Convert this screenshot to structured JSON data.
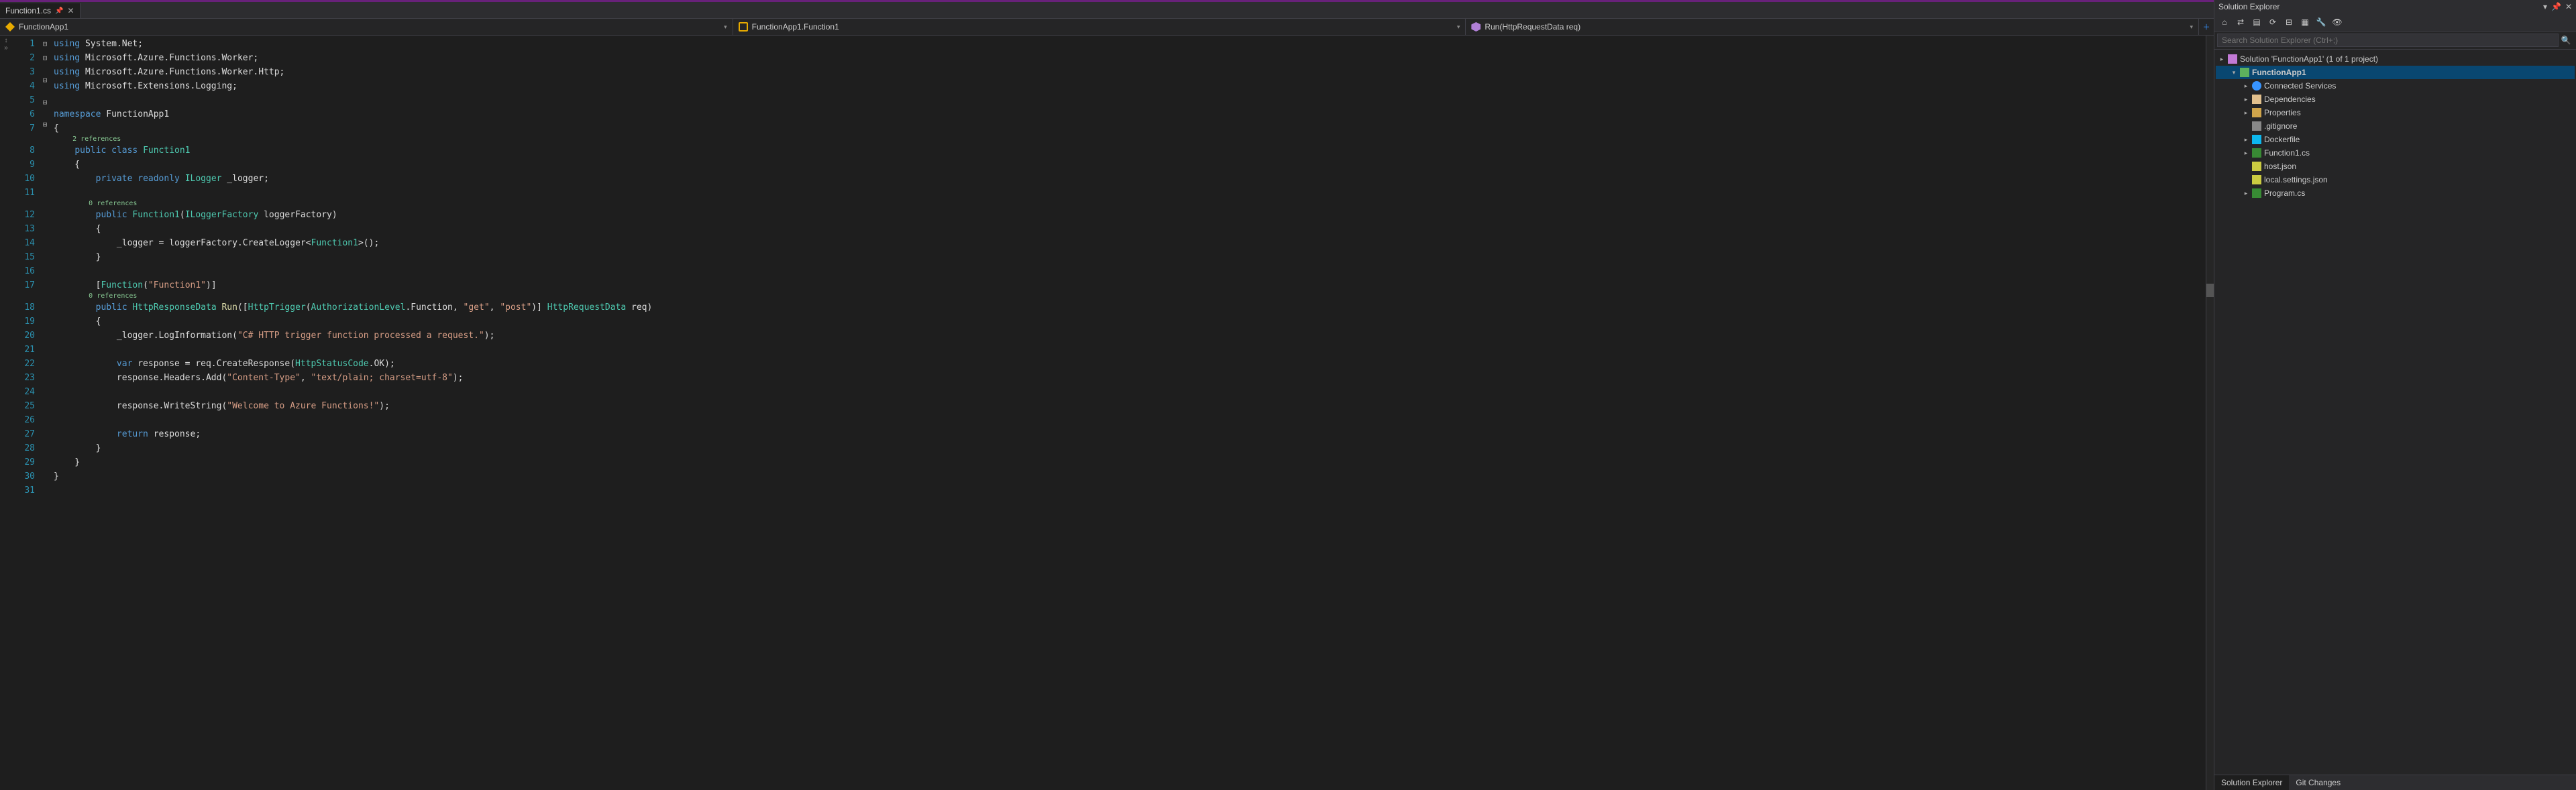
{
  "tabs": {
    "file": "Function1.cs"
  },
  "nav": {
    "ns": "FunctionApp1",
    "cls": "FunctionApp1.Function1",
    "mtd": "Run(HttpRequestData req)"
  },
  "code": {
    "lines": 31,
    "foldables": [
      1,
      6,
      8,
      12,
      18
    ],
    "codelens": [
      {
        "before_line": 8,
        "indent": 4,
        "text": "2 references"
      },
      {
        "before_line": 12,
        "indent": 8,
        "text": "0 references"
      },
      {
        "before_line": 18,
        "indent": 8,
        "text": "0 references"
      }
    ],
    "src": {
      "l1": "<span class='kw'>using</span> System.Net;",
      "l2": "<span class='kw'>using</span> Microsoft.Azure.Functions.Worker;",
      "l3": "<span class='kw'>using</span> Microsoft.Azure.Functions.Worker.Http;",
      "l4": "<span class='kw'>using</span> Microsoft.Extensions.Logging;",
      "l5": "",
      "l6": "<span class='kw'>namespace</span> FunctionApp1",
      "l7": "{",
      "l8": "    <span class='kw'>public class</span> <span class='ty'>Function1</span>",
      "l9": "    {",
      "l10": "        <span class='kw'>private readonly</span> <span class='ty'>ILogger</span> _logger;",
      "l11": "",
      "l12": "        <span class='kw'>public</span> <span class='ty'>Function1</span>(<span class='ty'>ILoggerFactory</span> loggerFactory)",
      "l13": "        {",
      "l14": "            _logger = loggerFactory.CreateLogger&lt;<span class='ty'>Function1</span>&gt;();",
      "l15": "        }",
      "l16": "",
      "l17": "        [<span class='ty'>Function</span>(<span class='str'>\"Function1\"</span>)]",
      "l18": "        <span class='kw'>public</span> <span class='ty'>HttpResponseData</span> <span class='mth'>Run</span>([<span class='ty'>HttpTrigger</span>(<span class='ty'>AuthorizationLevel</span>.Function, <span class='str'>\"get\"</span>, <span class='str'>\"post\"</span>)] <span class='ty'>HttpRequestData</span> req)",
      "l19": "        {",
      "l20": "            _logger.LogInformation(<span class='str'>\"C# HTTP trigger function processed a request.\"</span>);",
      "l21": "",
      "l22": "            <span class='kw'>var</span> response = req.CreateResponse(<span class='ty'>HttpStatusCode</span>.OK);",
      "l23": "            response.Headers.Add(<span class='str'>\"Content-Type\"</span>, <span class='str'>\"text/plain; charset=utf-8\"</span>);",
      "l24": "",
      "l25": "            response.WriteString(<span class='str'>\"Welcome to Azure Functions!\"</span>);",
      "l26": "",
      "l27": "            <span class='kw'>return</span> response;",
      "l28": "        }",
      "l29": "    }",
      "l30": "}",
      "l31": ""
    }
  },
  "sln": {
    "title": "Solution Explorer",
    "search_ph": "Search Solution Explorer (Ctrl+;)",
    "root": "Solution 'FunctionApp1' (1 of 1 project)",
    "proj": "FunctionApp1",
    "items": [
      {
        "k": "svc",
        "t": "Connected Services",
        "exp": true
      },
      {
        "k": "dep",
        "t": "Dependencies",
        "exp": true
      },
      {
        "k": "prop",
        "t": "Properties",
        "exp": true
      },
      {
        "k": "txt",
        "t": ".gitignore"
      },
      {
        "k": "dock",
        "t": "Dockerfile",
        "exp": true
      },
      {
        "k": "cs",
        "t": "Function1.cs",
        "exp": true
      },
      {
        "k": "json",
        "t": "host.json"
      },
      {
        "k": "json",
        "t": "local.settings.json"
      },
      {
        "k": "cs",
        "t": "Program.cs",
        "exp": true
      }
    ],
    "bottom": {
      "a": "Solution Explorer",
      "b": "Git Changes"
    }
  }
}
